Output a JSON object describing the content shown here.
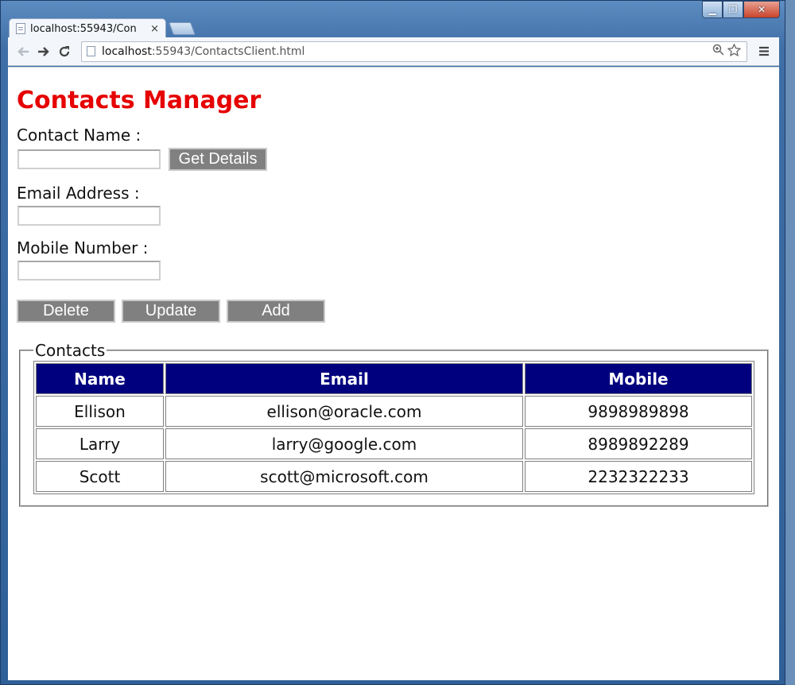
{
  "browser": {
    "tab_title": "localhost:55943/Con",
    "tab_close": "×",
    "url_host": "localhost",
    "url_rest": ":55943/ContactsClient.html",
    "window_controls": {
      "minimize": "▁",
      "maximize": "❐",
      "close": "✕"
    }
  },
  "page": {
    "title": "Contacts Manager",
    "contact_name_label": "Contact Name :",
    "contact_name_value": "",
    "get_details_label": "Get Details",
    "email_label": "Email Address :",
    "email_value": "",
    "mobile_label": "Mobile Number :",
    "mobile_value": "",
    "actions": {
      "delete": "Delete",
      "update": "Update",
      "add": "Add"
    },
    "contacts_legend": "Contacts",
    "table": {
      "headers": [
        "Name",
        "Email",
        "Mobile"
      ],
      "rows": [
        [
          "Ellison",
          "ellison@oracle.com",
          "9898989898"
        ],
        [
          "Larry",
          "larry@google.com",
          "8989892289"
        ],
        [
          "Scott",
          "scott@microsoft.com",
          "2232322233"
        ]
      ]
    }
  },
  "colors": {
    "title": "#e60000",
    "header_bg": "#00007f",
    "button_bg": "#808080"
  },
  "icons": [
    "back-arrow-icon",
    "forward-arrow-icon",
    "reload-icon",
    "page-icon",
    "zoom-icon",
    "star-icon",
    "menu-icon",
    "close-icon"
  ]
}
